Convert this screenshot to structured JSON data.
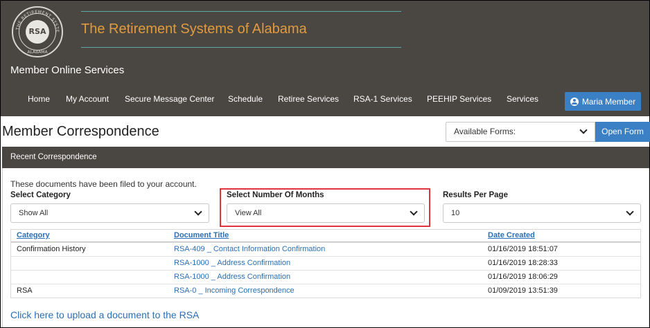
{
  "header": {
    "logo_text": "RSA",
    "logo_ring_text": "THE RETIREMENT SYSTEMS OF ALABAMA",
    "site_title": "The Retirement Systems of Alabama",
    "subtitle": "Member Online Services",
    "nav": [
      "Home",
      "My Account",
      "Secure Message Center",
      "Schedule",
      "Retiree Services",
      "RSA-1 Services",
      "PEEHIP Services",
      "Services"
    ],
    "user_button": "Maria Member"
  },
  "page": {
    "title": "Member Correspondence",
    "forms_select": "Available Forms:",
    "open_form_button": "Open Form"
  },
  "panel": {
    "title": "Recent Correspondence",
    "intro": "These documents have been filed to your account.",
    "filters": {
      "category_label": "Select Category",
      "category_value": "Show All",
      "months_label": "Select Number Of Months",
      "months_value": "View All",
      "results_label": "Results Per Page",
      "results_value": "10"
    },
    "table": {
      "headers": [
        "Category",
        "Document Title",
        "Date Created"
      ],
      "rows": [
        {
          "category": "Confirmation History",
          "title": "RSA-409 _ Contact Information Confirmation",
          "date": "01/16/2019 18:51:07"
        },
        {
          "category": "",
          "title": "RSA-1000 _ Address Confirmation",
          "date": "01/16/2019 18:28:33"
        },
        {
          "category": "",
          "title": "RSA-1000 _ Address Confirmation",
          "date": "01/16/2019 18:06:29"
        },
        {
          "category": "RSA",
          "title": "RSA-0 _ Incoming Correspondence",
          "date": "01/09/2019 13:51:39"
        }
      ]
    },
    "upload_link": "Click here to upload a document to the RSA"
  },
  "colors": {
    "header_bg": "#4a4743",
    "title_orange": "#e09a3f",
    "accent_blue": "#3b7fc4",
    "highlight_red": "#e0333a"
  }
}
